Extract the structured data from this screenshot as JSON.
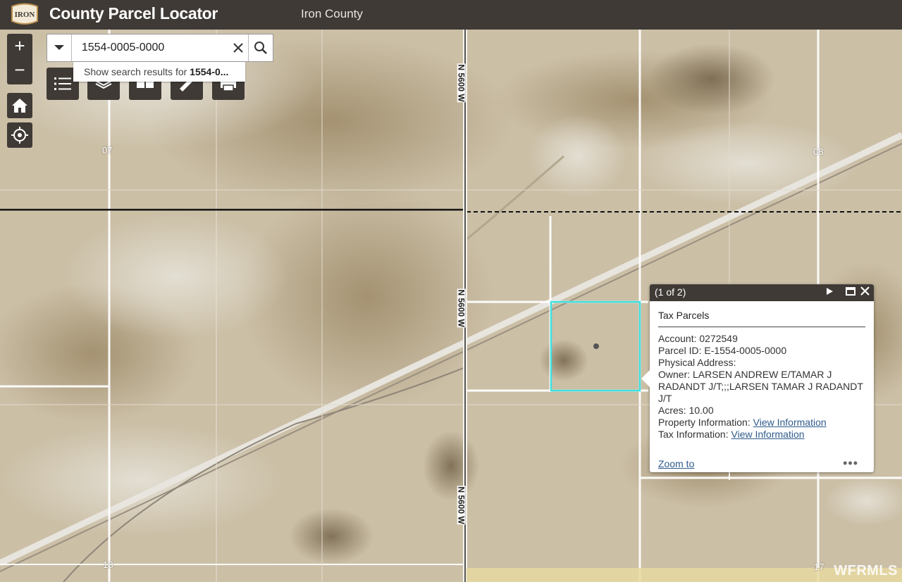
{
  "header": {
    "logo_text": "IRON",
    "title": "County Parcel Locator",
    "subtitle": "Iron County"
  },
  "map": {
    "section_labels": [
      "07",
      "08",
      "18",
      "17"
    ],
    "road_label": "N 5600 W",
    "watermark": "WFRMLS"
  },
  "zoom": {
    "in": "+",
    "out": "−"
  },
  "search": {
    "value": "1554-0005-0000",
    "suggestion_prefix": "Show search results for ",
    "suggestion_term": "1554-0..."
  },
  "popup": {
    "counter": "(1 of 2)",
    "layer": "Tax Parcels",
    "fields": [
      {
        "label": "Account:",
        "value": " 0272549"
      },
      {
        "label": "Parcel ID:",
        "value": " E-1554-0005-0000"
      },
      {
        "label": "Physical Address:",
        "value": ""
      },
      {
        "label": "Owner:",
        "value": " LARSEN ANDREW E/TAMAR J RADANDT J/T;;;LARSEN TAMAR J RADANDT J/T"
      },
      {
        "label": "Acres:",
        "value": " 10.00"
      }
    ],
    "links": [
      {
        "label": "Property Information:",
        "link": "View Information"
      },
      {
        "label": "Tax Information:",
        "link": "View Information"
      }
    ],
    "zoom_to": "Zoom to",
    "more": "•••"
  },
  "colors": {
    "header_bg": "#3f3a35",
    "parcel_highlight": "#3fe0e0",
    "link": "#2f5b8c"
  }
}
